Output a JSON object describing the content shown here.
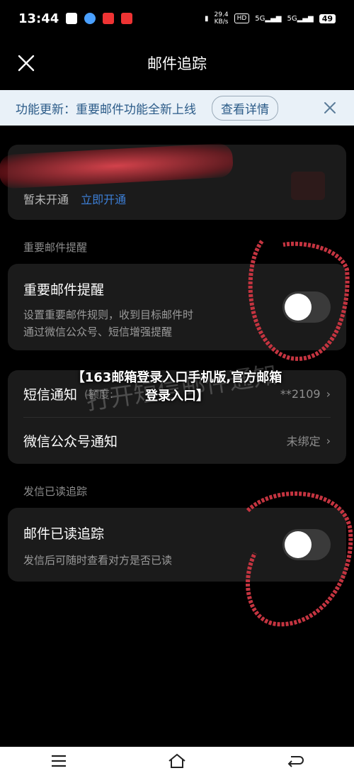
{
  "status_bar": {
    "time": "13:44",
    "net_speed": "29.4",
    "net_unit": "KB/s",
    "hd": "HD",
    "signal_1": "5G",
    "signal_2": "5G",
    "battery": "49"
  },
  "header": {
    "title": "邮件追踪",
    "close_icon": "close-icon"
  },
  "notice": {
    "text": "功能更新：重要邮件功能全新上线",
    "detail_label": "查看详情"
  },
  "account": {
    "status_text": "暂未开通",
    "activate_label": "立即开通"
  },
  "important_section": {
    "label": "重要邮件提醒",
    "row_title": "重要邮件提醒",
    "description_line1": "设置重要邮件规则，收到目标邮件时",
    "description_line2": "通过微信公众号、短信增强提醒",
    "toggle_on": false
  },
  "notify_list": {
    "sms_label": "短信通知",
    "sms_note": "(额度:",
    "sms_value": "**2109",
    "wechat_label": "微信公众号通知",
    "wechat_value": "未绑定"
  },
  "read_section": {
    "label": "发信已读追踪",
    "row_title": "邮件已读追踪",
    "description": "发信后可随时查看对方是否已读",
    "toggle_on": false
  },
  "overlay": {
    "title_line1": "【163邮箱登录入口手机版,官方邮箱",
    "title_line2": "登录入口】",
    "watermark": "打开短信邮件通知"
  },
  "nav": {
    "menu_icon": "menu-icon",
    "home_icon": "home-icon",
    "back_icon": "back-icon"
  },
  "colors": {
    "accent_link": "#3d7fd6",
    "notice_bg": "#e9f1f8",
    "card_bg": "#1b1b1b"
  }
}
